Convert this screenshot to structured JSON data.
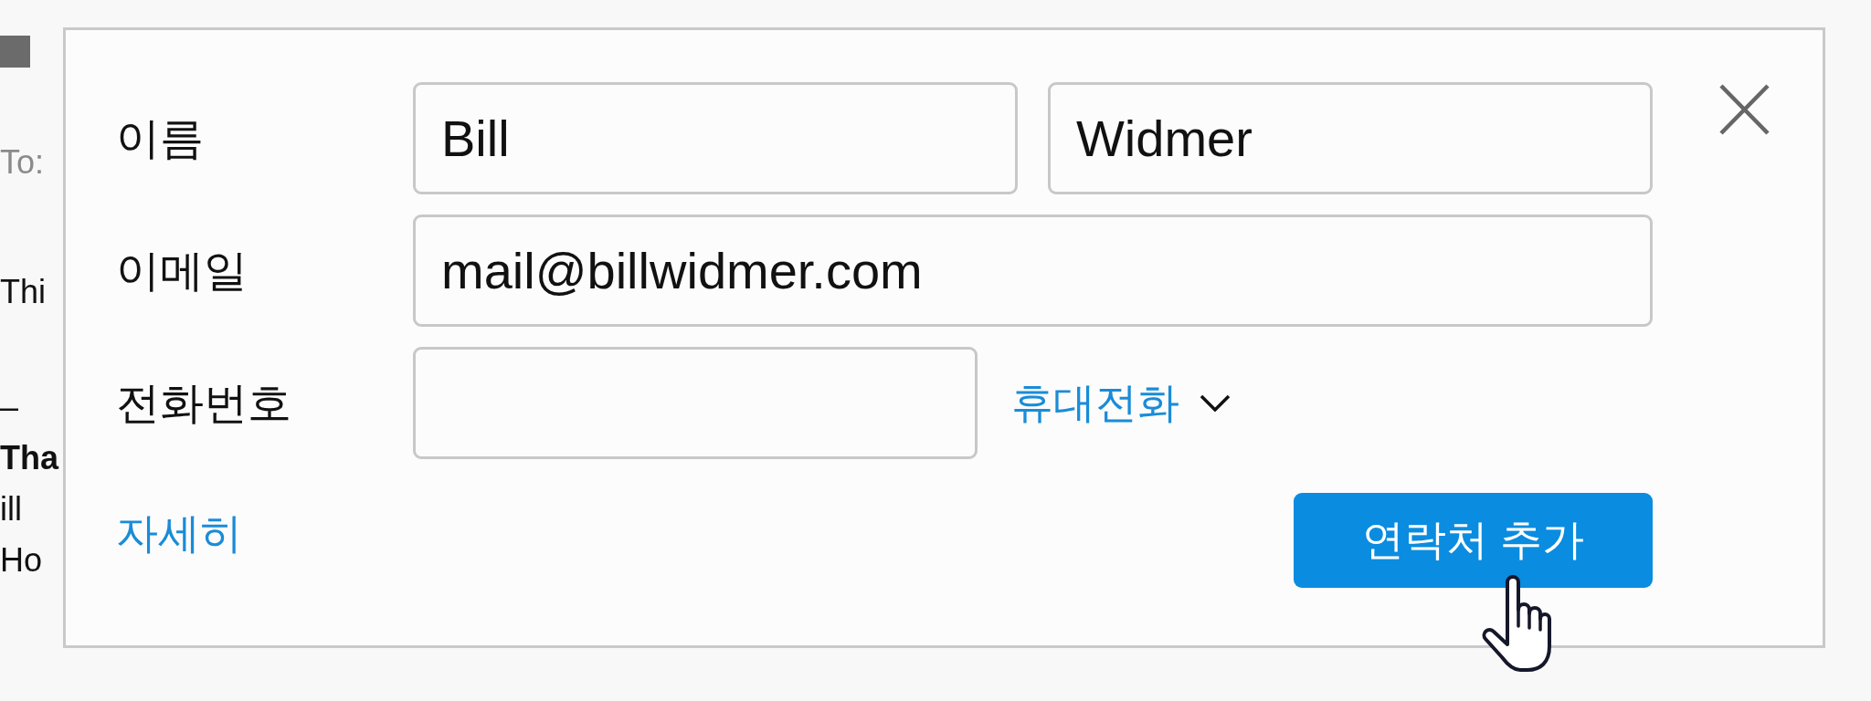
{
  "background_email": {
    "to_label": "To:",
    "body": "Thi",
    "signature": [
      {
        "text": "–",
        "kind": "plain"
      },
      {
        "text": "Tha",
        "kind": "bold"
      },
      {
        "text": "ill",
        "kind": "plain"
      },
      {
        "text": "Ho",
        "kind": "plain"
      }
    ]
  },
  "dialog": {
    "fields": [
      {
        "label": "이름",
        "kind": "name",
        "values": [
          "Bill",
          "Widmer"
        ]
      },
      {
        "label": "이메일",
        "kind": "email",
        "value": "mail@billwidmer.com"
      },
      {
        "label": "전화번호",
        "kind": "phone",
        "type_dropdown": "휴대전화"
      }
    ],
    "more_link": "자세히",
    "submit_button": "연락처 추가"
  }
}
